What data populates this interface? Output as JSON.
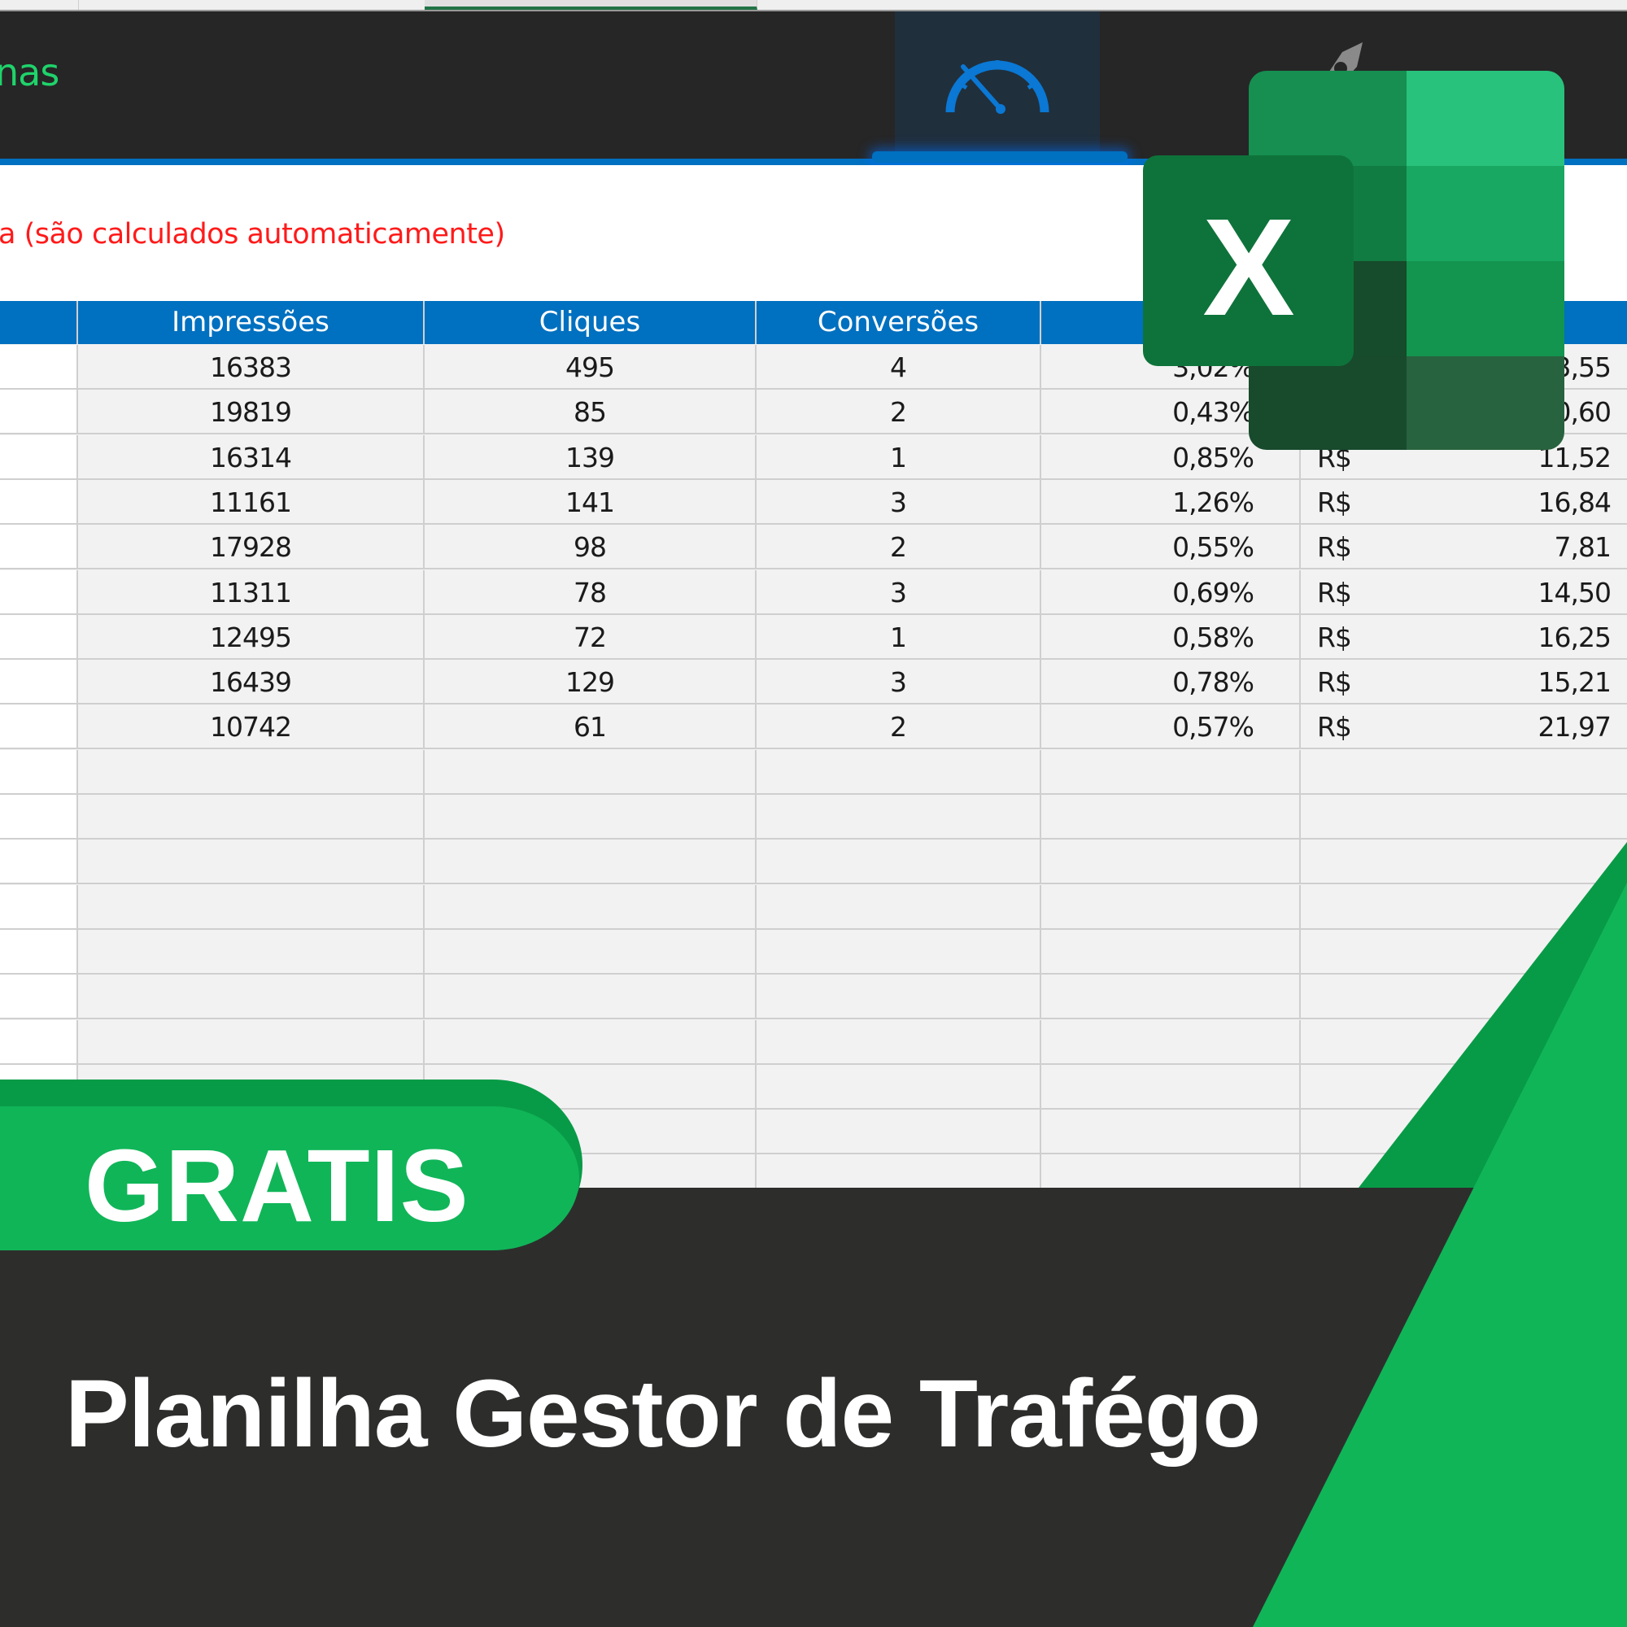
{
  "app": {
    "title_fragment": "nas",
    "note": "a (são calculados automaticamente)"
  },
  "nav": {
    "items": [
      {
        "icon": "speedometer-icon",
        "active": true
      },
      {
        "icon": "rocket-icon",
        "active": false
      }
    ]
  },
  "table": {
    "columns": [
      "",
      "Impressões",
      "Cliques",
      "Conversões",
      "%",
      ""
    ],
    "rows": [
      {
        "impressoes": "16383",
        "cliques": "495",
        "conversoes": "4",
        "taxa": "3,02%",
        "moeda": "",
        "valor": "3,55"
      },
      {
        "impressoes": "19819",
        "cliques": "85",
        "conversoes": "2",
        "taxa": "0,43%",
        "moeda": "",
        "valor": "0,60"
      },
      {
        "impressoes": "16314",
        "cliques": "139",
        "conversoes": "1",
        "taxa": "0,85%",
        "moeda": "R$",
        "valor": "11,52"
      },
      {
        "impressoes": "11161",
        "cliques": "141",
        "conversoes": "3",
        "taxa": "1,26%",
        "moeda": "R$",
        "valor": "16,84"
      },
      {
        "impressoes": "17928",
        "cliques": "98",
        "conversoes": "2",
        "taxa": "0,55%",
        "moeda": "R$",
        "valor": "7,81"
      },
      {
        "impressoes": "11311",
        "cliques": "78",
        "conversoes": "3",
        "taxa": "0,69%",
        "moeda": "R$",
        "valor": "14,50"
      },
      {
        "impressoes": "12495",
        "cliques": "72",
        "conversoes": "1",
        "taxa": "0,58%",
        "moeda": "R$",
        "valor": "16,25"
      },
      {
        "impressoes": "16439",
        "cliques": "129",
        "conversoes": "3",
        "taxa": "0,78%",
        "moeda": "R$",
        "valor": "15,21"
      },
      {
        "impressoes": "10742",
        "cliques": "61",
        "conversoes": "2",
        "taxa": "0,57%",
        "moeda": "R$",
        "valor": "21,97"
      }
    ],
    "empty_rows": 10
  },
  "logo": {
    "letter": "X",
    "name": "excel-logo"
  },
  "banner": {
    "badge": "GRATIS",
    "title": "Planilha Gestor de Trafégo"
  },
  "colors": {
    "header_blue": "#0070c0",
    "brand_green": "#10b558",
    "dark_green": "#089b47",
    "dark_bg": "#2d2e2c",
    "note_red": "#ff1a1a",
    "title_green": "#1fd36b"
  }
}
